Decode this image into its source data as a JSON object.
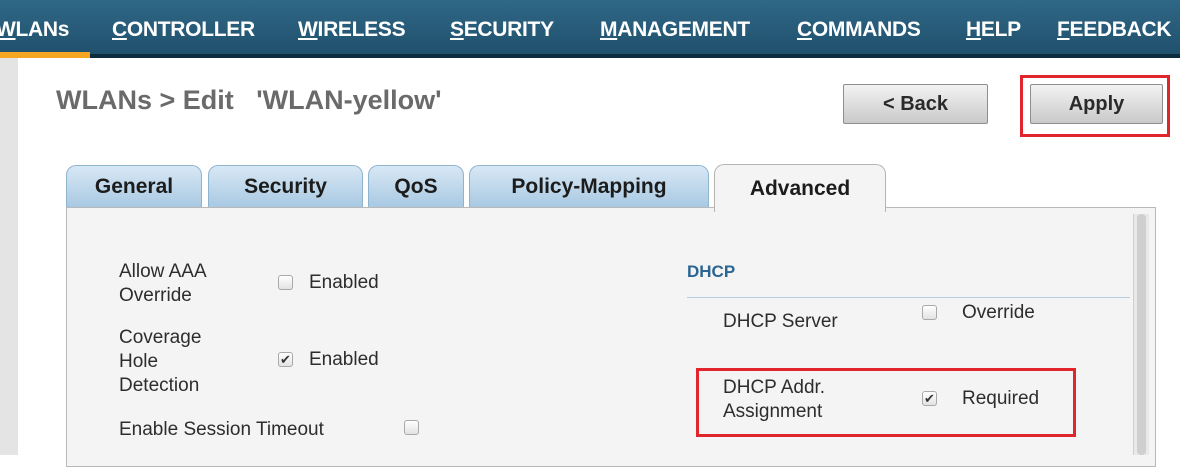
{
  "nav": {
    "items": [
      {
        "label": "WLANs"
      },
      {
        "label": "CONTROLLER"
      },
      {
        "label": "WIRELESS"
      },
      {
        "label": "SECURITY"
      },
      {
        "label": "MANAGEMENT"
      },
      {
        "label": "COMMANDS"
      },
      {
        "label": "HELP"
      },
      {
        "label": "FEEDBACK"
      }
    ]
  },
  "header": {
    "title": "WLANs > Edit   'WLAN-yellow'",
    "back_label": "< Back",
    "apply_label": "Apply"
  },
  "tabs": [
    {
      "label": "General"
    },
    {
      "label": "Security"
    },
    {
      "label": "QoS"
    },
    {
      "label": "Policy-Mapping"
    },
    {
      "label": "Advanced",
      "active": true
    }
  ],
  "left_settings": {
    "aaa_override": {
      "label_line1": "Allow AAA",
      "label_line2": "Override",
      "value_label": "Enabled",
      "checked": false
    },
    "coverage_hole": {
      "label_line1": "Coverage",
      "label_line2": "Hole",
      "label_line3": "Detection",
      "value_label": "Enabled",
      "checked": true
    },
    "session_timeout": {
      "label": "Enable Session Timeout",
      "checked": false
    }
  },
  "dhcp": {
    "heading": "DHCP",
    "server": {
      "label": "DHCP Server",
      "value_label": "Override",
      "checked": false
    },
    "addr_assignment": {
      "label_line1": "DHCP Addr.",
      "label_line2": "Assignment",
      "value_label": "Required",
      "checked": true
    }
  },
  "checkmark": "✔",
  "colors": {
    "nav_bg": "#2f6786",
    "nav_active": "#f5a623",
    "highlight": "#e0262b",
    "section_heading": "#2b6591"
  }
}
